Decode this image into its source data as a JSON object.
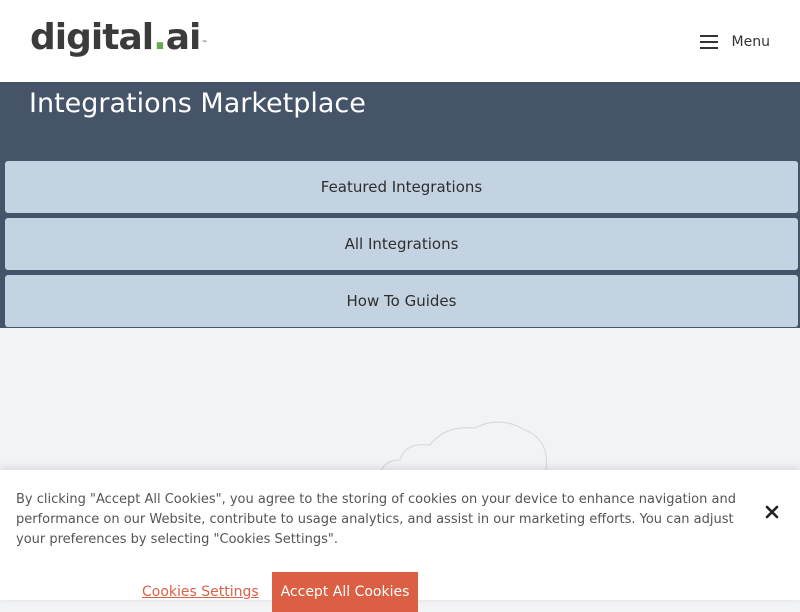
{
  "header": {
    "logo": {
      "part1": "digit",
      "part2": "al",
      "dot": ".",
      "part3": "ai",
      "tm": "™"
    },
    "menu_label": "Menu"
  },
  "hero": {
    "title": "Integrations Marketplace"
  },
  "nav": {
    "items": [
      {
        "label": "Featured Integrations"
      },
      {
        "label": "All Integrations"
      },
      {
        "label": "How To Guides"
      }
    ]
  },
  "cookie_banner": {
    "text": "By clicking \"Accept All Cookies\", you agree to the storing of cookies on your device to enhance navigation and performance on our Website, contribute to usage analytics, and assist in our marketing efforts. You can adjust your preferences by selecting \"Cookies Settings\".",
    "settings_label": "Cookies Settings",
    "accept_label": "Accept All Cookies",
    "close_icon": "close-icon"
  },
  "colors": {
    "hero_bg": "#465469",
    "nav_bg": "#c4d3e2",
    "accent": "#db5f43",
    "logo_green": "#6aa84f"
  }
}
